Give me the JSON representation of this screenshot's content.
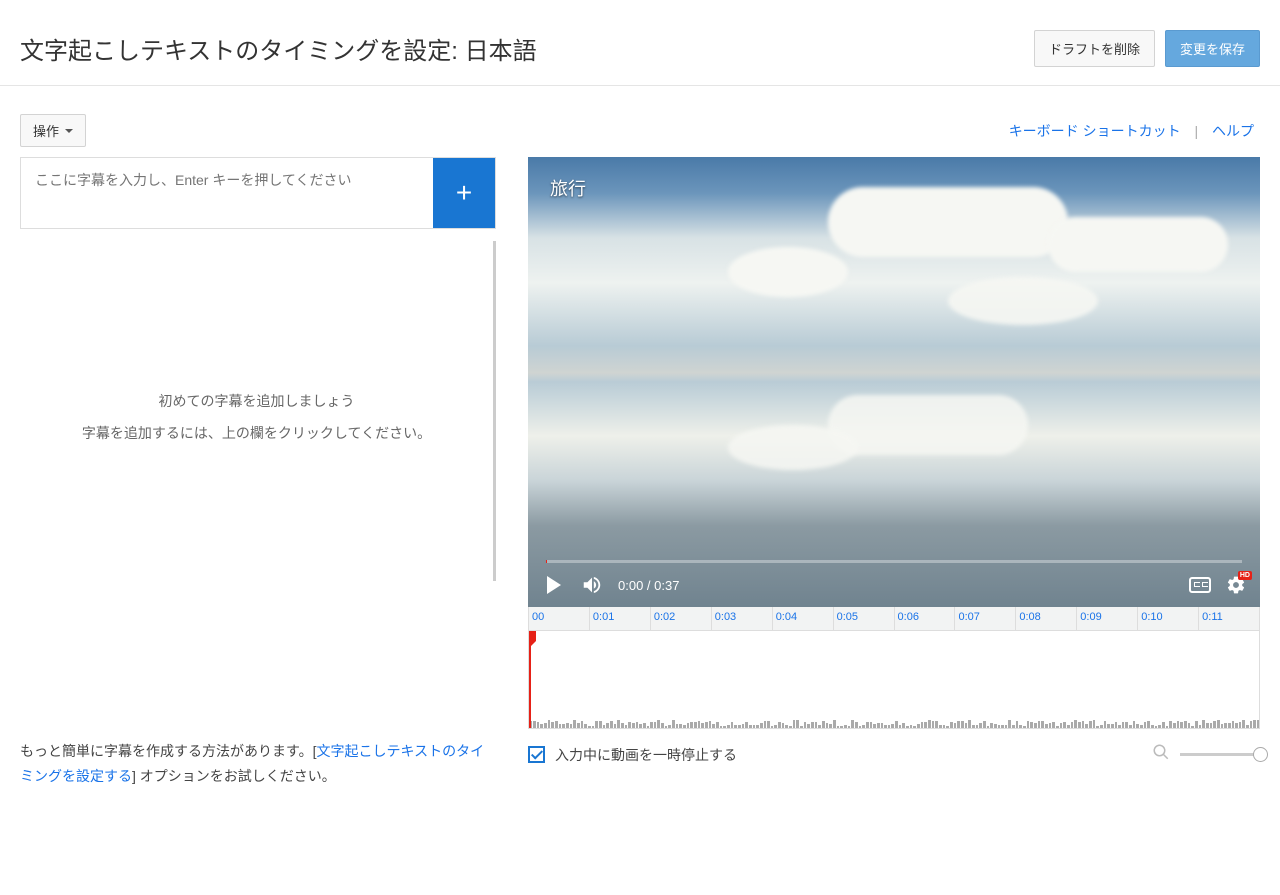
{
  "header": {
    "title": "文字起こしテキストのタイミングを設定: 日本語",
    "delete_draft": "ドラフトを削除",
    "save_changes": "変更を保存"
  },
  "toolbar": {
    "actions_label": "操作",
    "shortcuts_link": "キーボード ショートカット",
    "help_link": "ヘルプ"
  },
  "subtitle_input": {
    "placeholder": "ここに字幕を入力し、Enter キーを押してください"
  },
  "empty_state": {
    "title": "初めての字幕を追加しましょう",
    "subtitle": "字幕を追加するには、上の欄をクリックしてください。"
  },
  "tip": {
    "prefix": "もっと簡単に字幕を作成する方法があります。[",
    "link": "文字起こしテキストのタイミングを設定する",
    "suffix": "] オプションをお試しください。"
  },
  "video": {
    "overlay_title": "旅行",
    "time_display": "0:00 / 0:37"
  },
  "timeline": {
    "ticks": [
      "00",
      "0:01",
      "0:02",
      "0:03",
      "0:04",
      "0:05",
      "0:06",
      "0:07",
      "0:08",
      "0:09",
      "0:10",
      "0:11"
    ]
  },
  "footer": {
    "pause_label": "入力中に動画を一時停止する"
  }
}
